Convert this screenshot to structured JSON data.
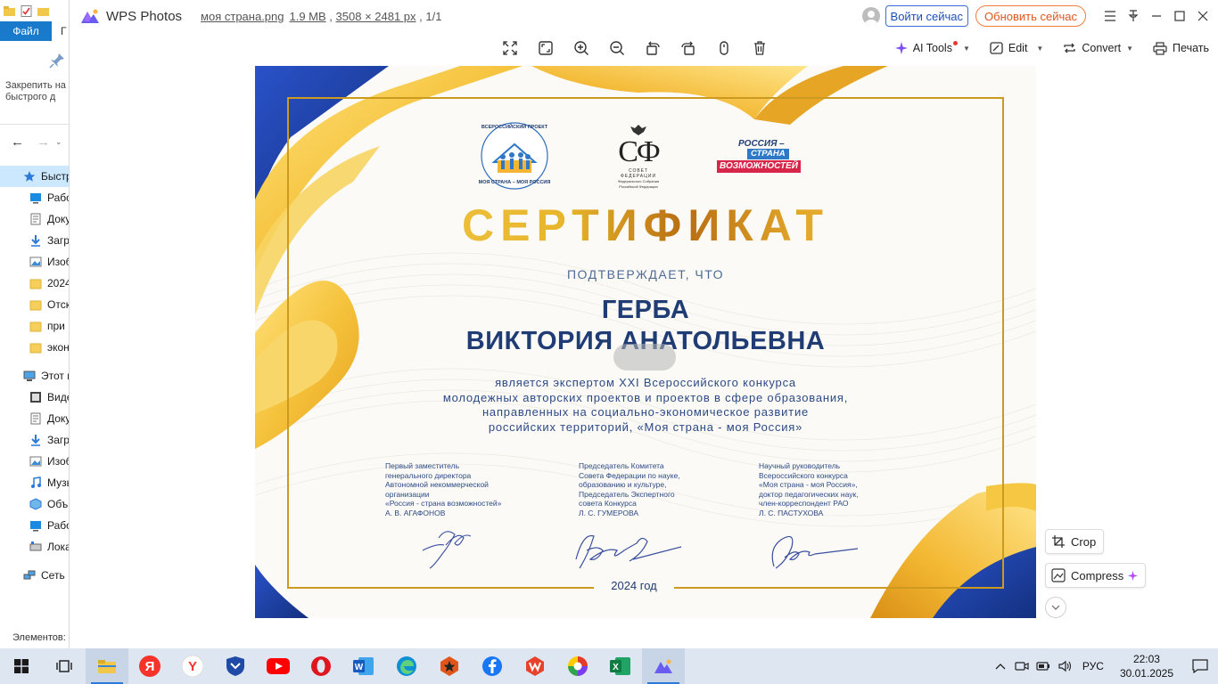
{
  "explorer": {
    "ribbon_tab_file": "Файл",
    "ribbon_tab_2": "Г",
    "pin_label_1": "Закрепить на",
    "pin_label_2": "быстрого д",
    "tree": [
      {
        "label": "Быстр",
        "level": 1,
        "selected": true,
        "icon": "star-icon"
      },
      {
        "label": "Рабо",
        "level": 2,
        "icon": "desktop-icon"
      },
      {
        "label": "Доку",
        "level": 2,
        "icon": "document-icon"
      },
      {
        "label": "Загр",
        "level": 2,
        "icon": "download-icon"
      },
      {
        "label": "Изоб",
        "level": 2,
        "icon": "image-icon"
      },
      {
        "label": "2024",
        "level": 2,
        "icon": "folder-icon"
      },
      {
        "label": "Отск",
        "level": 2,
        "icon": "folder-icon"
      },
      {
        "label": "при",
        "level": 2,
        "icon": "folder-icon"
      },
      {
        "label": "экон",
        "level": 2,
        "icon": "folder-icon"
      },
      {
        "label": "Этот к",
        "level": 1,
        "icon": "computer-icon"
      },
      {
        "label": "Виде",
        "level": 2,
        "icon": "video-icon"
      },
      {
        "label": "Доку",
        "level": 2,
        "icon": "document-icon"
      },
      {
        "label": "Загр",
        "level": 2,
        "icon": "download-icon"
      },
      {
        "label": "Изоб",
        "level": 2,
        "icon": "image-icon"
      },
      {
        "label": "Музы",
        "level": 2,
        "icon": "music-icon"
      },
      {
        "label": "Объ",
        "level": 2,
        "icon": "3d-objects-icon"
      },
      {
        "label": "Рабо",
        "level": 2,
        "icon": "desktop-icon"
      },
      {
        "label": "Лока",
        "level": 2,
        "icon": "drive-icon"
      },
      {
        "label": "Сеть",
        "level": 1,
        "icon": "network-icon"
      }
    ],
    "status": "Элементов:"
  },
  "wps": {
    "app_name": "WPS Photos",
    "file_name": "моя страна.png",
    "file_size": "1.9 MB",
    "dimensions": "3508 × 2481 px",
    "page_counter": "1/1",
    "login_button": "Войти сейчас",
    "upgrade_button": "Обновить сейчас",
    "toolbar": {
      "ai_tools": "AI Tools",
      "edit": "Edit",
      "convert": "Convert",
      "print": "Печать"
    },
    "side": {
      "crop": "Crop",
      "compress": "Compress"
    }
  },
  "certificate": {
    "title": "СЕРТИФИКАТ",
    "subtitle": "ПОДТВЕРЖДАЕТ, ЧТО",
    "name_line1": "ГЕРБА",
    "name_line2": "ВИКТОРИЯ АНАТОЛЬЕВНА",
    "description": [
      "является экспертом XXI Всероссийского конкурса",
      "молодежных авторских проектов и проектов в сфере образования,",
      "направленных на социально-экономическое развитие",
      "российских территорий, «Моя страна - моя Россия»"
    ],
    "signatories": [
      {
        "lines": [
          "Первый заместитель",
          "генерального директора",
          "Автономной некоммерческой",
          "организации",
          "«Россия - страна возможностей»",
          "А. В. АГАФОНОВ"
        ]
      },
      {
        "lines": [
          "Председатель Комитета",
          "Совета Федерации по науке,",
          "образованию и культуре,",
          "Председатель Экспертного",
          "совета Конкурса",
          "Л. С. ГУМЕРОВА"
        ]
      },
      {
        "lines": [
          "Научный руководитель",
          "Всероссийского конкурса",
          "«Моя страна - моя Россия»,",
          "доктор педагогических наук,",
          "член-корреспондент РАО",
          "Л. С. ПАСТУХОВА"
        ]
      }
    ],
    "year": "2024 год",
    "logo_sf": {
      "letters": "СФ",
      "small": [
        "СОВЕТ",
        "ФЕДЕРАЦИИ",
        "Федерального Собрания",
        "Российской Федерации"
      ]
    },
    "logo_rsv": {
      "line1": "РОССИЯ –",
      "line2": "СТРАНА",
      "line3": "ВОЗМОЖНОСТЕЙ"
    },
    "logo_mp": {
      "arc_top": "ВСЕРОССИЙСКИЙ ПРОЕКТ",
      "arc_bottom": "МОЯ СТРАНА – МОЯ РОССИЯ"
    }
  },
  "taskbar": {
    "apps": [
      "start-icon",
      "task-view-icon",
      "file-explorer-icon",
      "yandex-icon",
      "yandex-browser-icon",
      "shield-app-icon",
      "youtube-icon",
      "opera-icon",
      "word-icon",
      "edge-icon",
      "vpn-star-icon",
      "facebook-icon",
      "wps-office-icon",
      "chrome-like-icon",
      "excel-icon",
      "wps-photos-icon"
    ],
    "language": "РУС",
    "time": "22:03",
    "date": "30.01.2025"
  },
  "colors": {
    "accent_blue": "#1f3c74",
    "ribbon_yellow": "#f3c23e",
    "ribbon_blue": "#1d3f9e",
    "frame_gold": "#cc9a1e",
    "explorer_file_tab": "#1979ca",
    "upgrade_orange": "#e0561b"
  }
}
